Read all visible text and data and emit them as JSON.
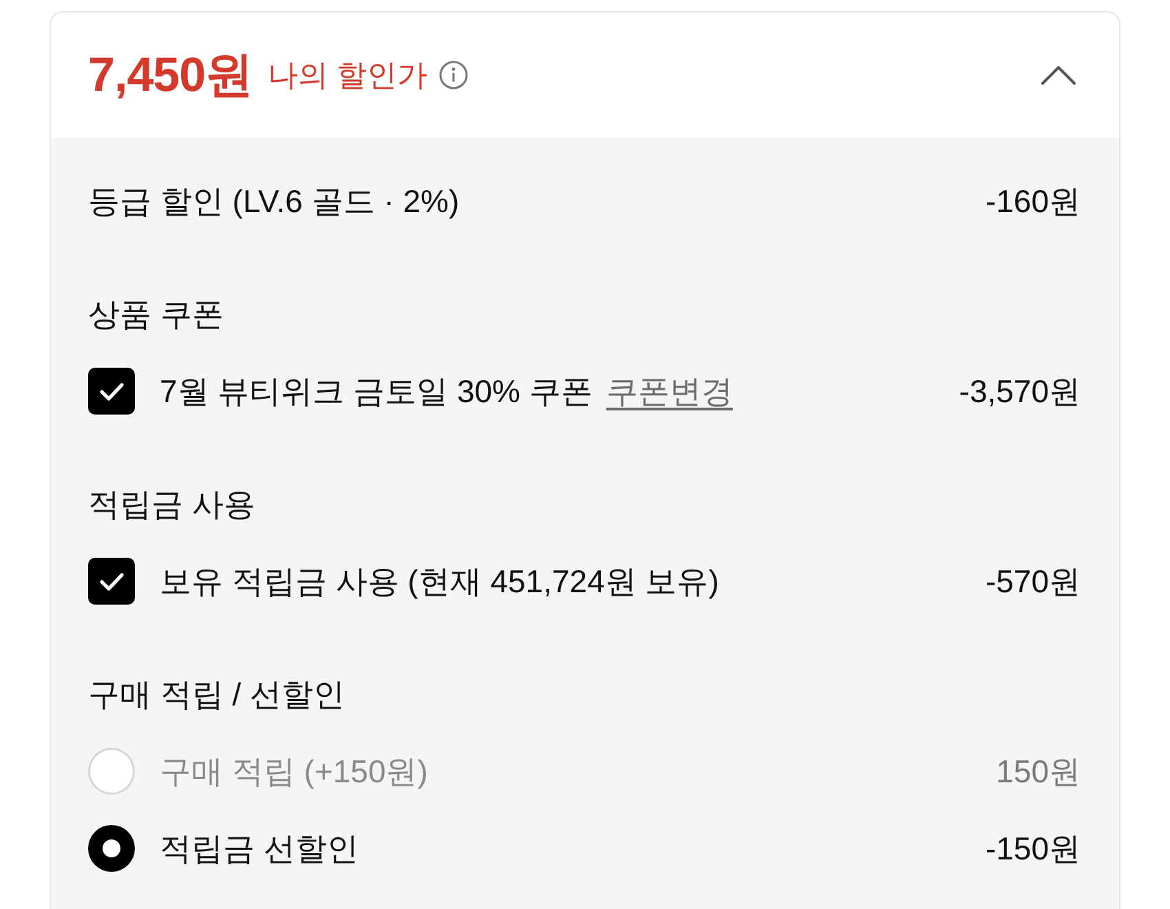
{
  "header": {
    "price": "7,450원",
    "label": "나의 할인가",
    "expanded": true
  },
  "sections": [
    {
      "items": [
        {
          "kind": "line",
          "label": "등급 할인 (LV.6 골드 · 2%)",
          "amount": "-160원"
        }
      ]
    },
    {
      "title": "상품 쿠폰",
      "items": [
        {
          "kind": "checkbox",
          "label": "7월 뷰티위크 금토일 30% 쿠폰",
          "link": "쿠폰변경",
          "amount": "-3,570원",
          "checked": true
        }
      ]
    },
    {
      "title": "적립금 사용",
      "items": [
        {
          "kind": "checkbox",
          "label": "보유 적립금 사용 (현재 451,724원 보유)",
          "amount": "-570원",
          "checked": true
        }
      ]
    },
    {
      "title": "구매 적립 / 선할인",
      "items": [
        {
          "kind": "radio",
          "label": "구매 적립 (+150원)",
          "amount": "150원",
          "selected": false
        },
        {
          "kind": "radio",
          "label": "적립금 선할인",
          "amount": "-150원",
          "selected": true
        }
      ]
    }
  ]
}
